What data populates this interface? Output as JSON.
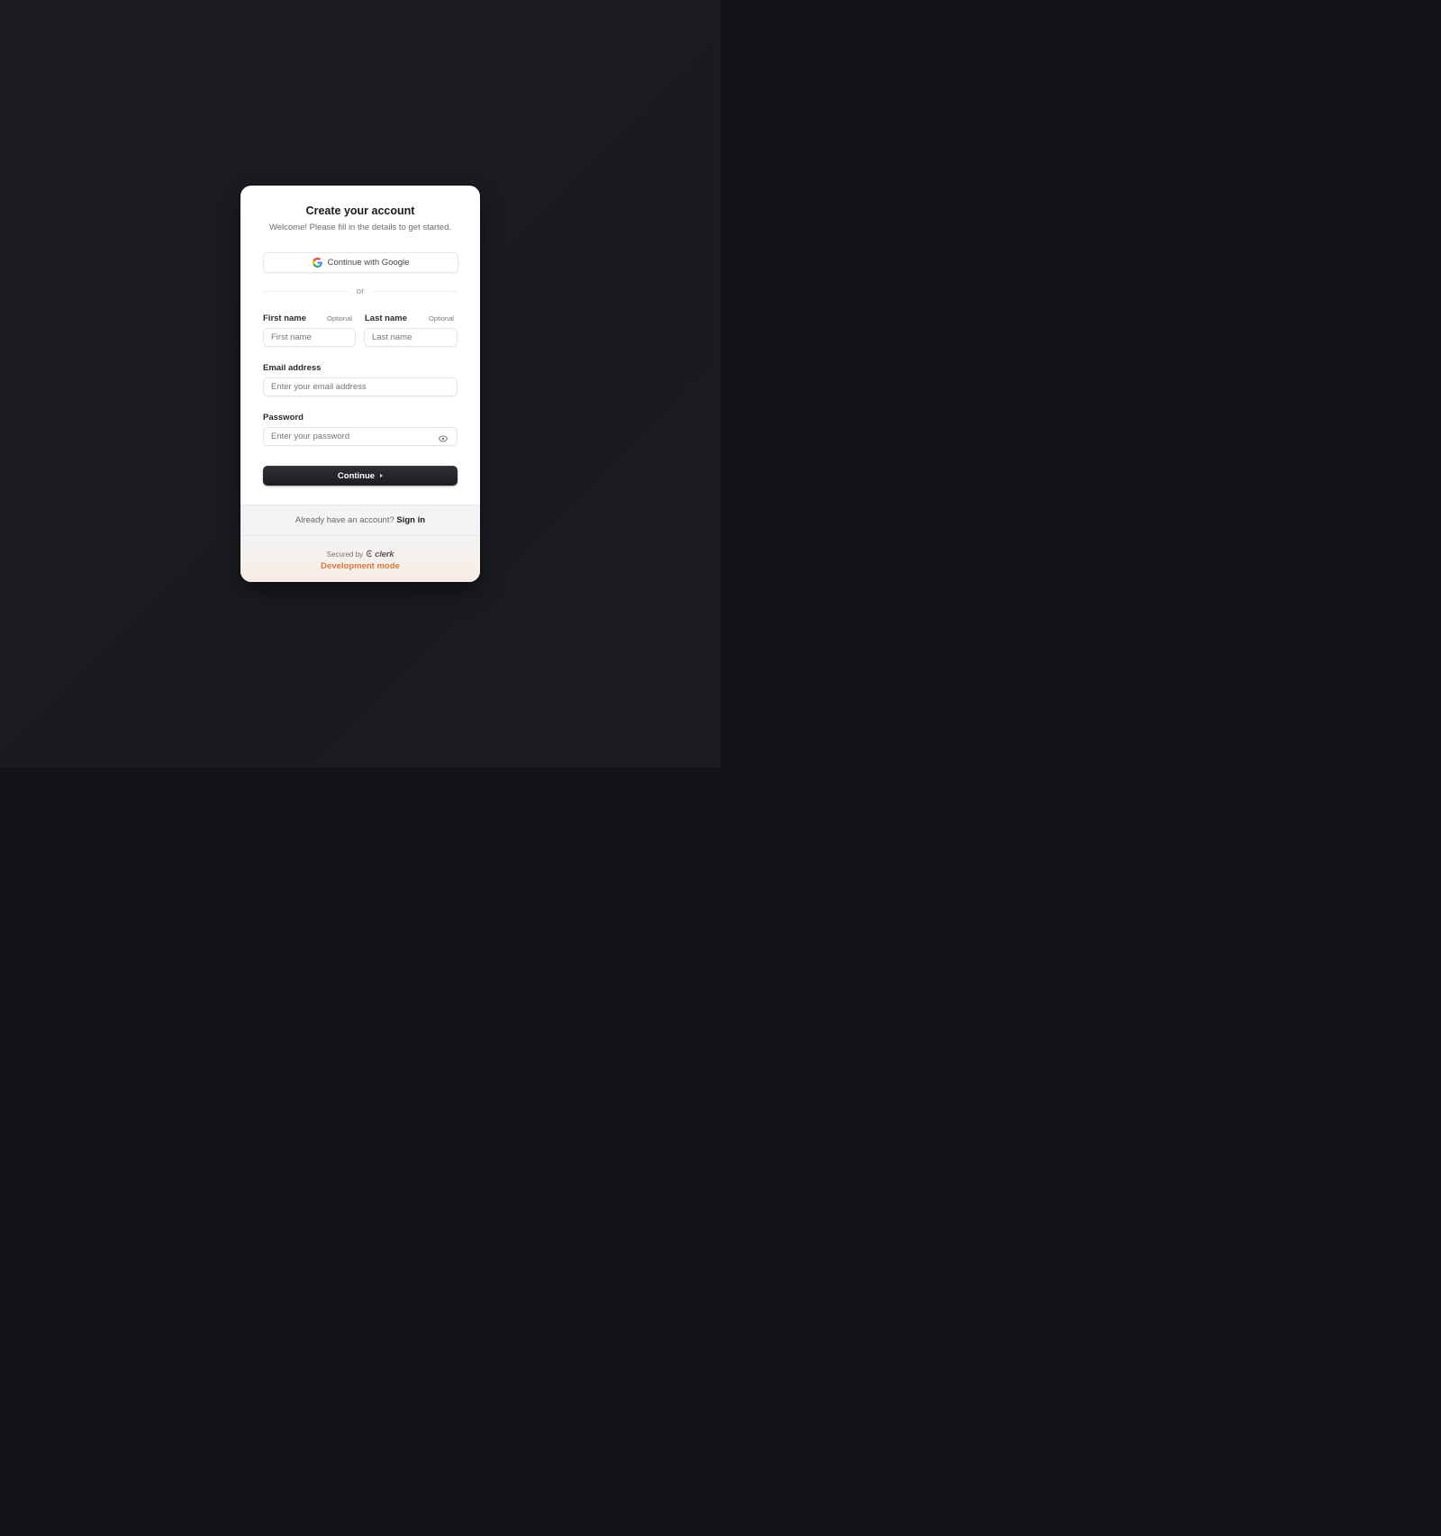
{
  "header": {
    "title": "Create your account",
    "subtitle": "Welcome! Please fill in the details to get started."
  },
  "social": {
    "google_label": "Continue with Google"
  },
  "divider_text": "or",
  "fields": {
    "first_name": {
      "label": "First name",
      "optional": "Optional",
      "placeholder": "First name",
      "value": ""
    },
    "last_name": {
      "label": "Last name",
      "optional": "Optional",
      "placeholder": "Last name",
      "value": ""
    },
    "email": {
      "label": "Email address",
      "placeholder": "Enter your email address",
      "value": ""
    },
    "password": {
      "label": "Password",
      "placeholder": "Enter your password",
      "value": ""
    }
  },
  "submit_label": "Continue",
  "footer": {
    "signin_prompt": "Already have an account?",
    "signin_link": "Sign in",
    "secured_by": "Secured by",
    "brand": "clerk",
    "dev_mode": "Development mode"
  },
  "colors": {
    "page_background": "#131419",
    "panel_background": "#1c1d22",
    "card_background": "#ffffff",
    "primary_button": "#222327",
    "dev_mode_accent": "#d9793f"
  },
  "icons": {
    "google": "google-icon",
    "password_toggle": "eye-icon",
    "continue": "caret-right-icon",
    "brand": "clerk-logo-icon"
  }
}
